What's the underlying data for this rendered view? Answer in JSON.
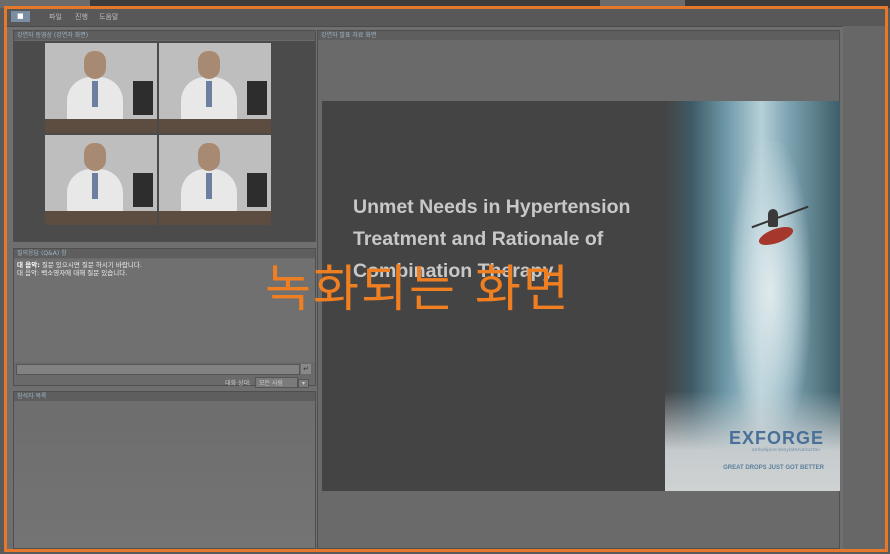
{
  "desktop_title": "",
  "menu": {
    "items": [
      "■",
      "파일",
      "진행",
      "도움말"
    ]
  },
  "video_panel": {
    "title": "강연자 동영상 (강연자 화면)",
    "cameras": [
      "cam-1",
      "cam-2",
      "cam-3",
      "cam-4"
    ]
  },
  "slide_panel": {
    "title": "강연자 발표 자료 화면"
  },
  "chat_panel": {
    "title": "질의응답 (Q&A) 창",
    "messages": [
      {
        "sender": "대 음악:",
        "text": "질문 있으시면 질문 하시기 바랍니다."
      },
      {
        "sender": "",
        "text": "대 음악: 백소영자에 대해 질문 있습니다."
      }
    ],
    "input_value": "",
    "send_icon": "enter-icon",
    "recipient_label": "대화 상대:",
    "recipient_value": "모든 사람"
  },
  "notes_panel": {
    "title": "참석자 목록"
  },
  "slide": {
    "title_lines": [
      "Unmet Needs in Hypertension",
      "Treatment and Rationale of",
      "Combination Therapy"
    ],
    "brand": "EXFORGE",
    "brand_sub": "amlodipine besylate/valsartan",
    "brand_tagline": "GREAT DROPS JUST GOT BETTER"
  },
  "overlay_caption": "녹화되는 화면",
  "colors": {
    "frame_border": "#e5782b",
    "overlay": "#f07f22",
    "menu_active": "#7a8da3"
  }
}
